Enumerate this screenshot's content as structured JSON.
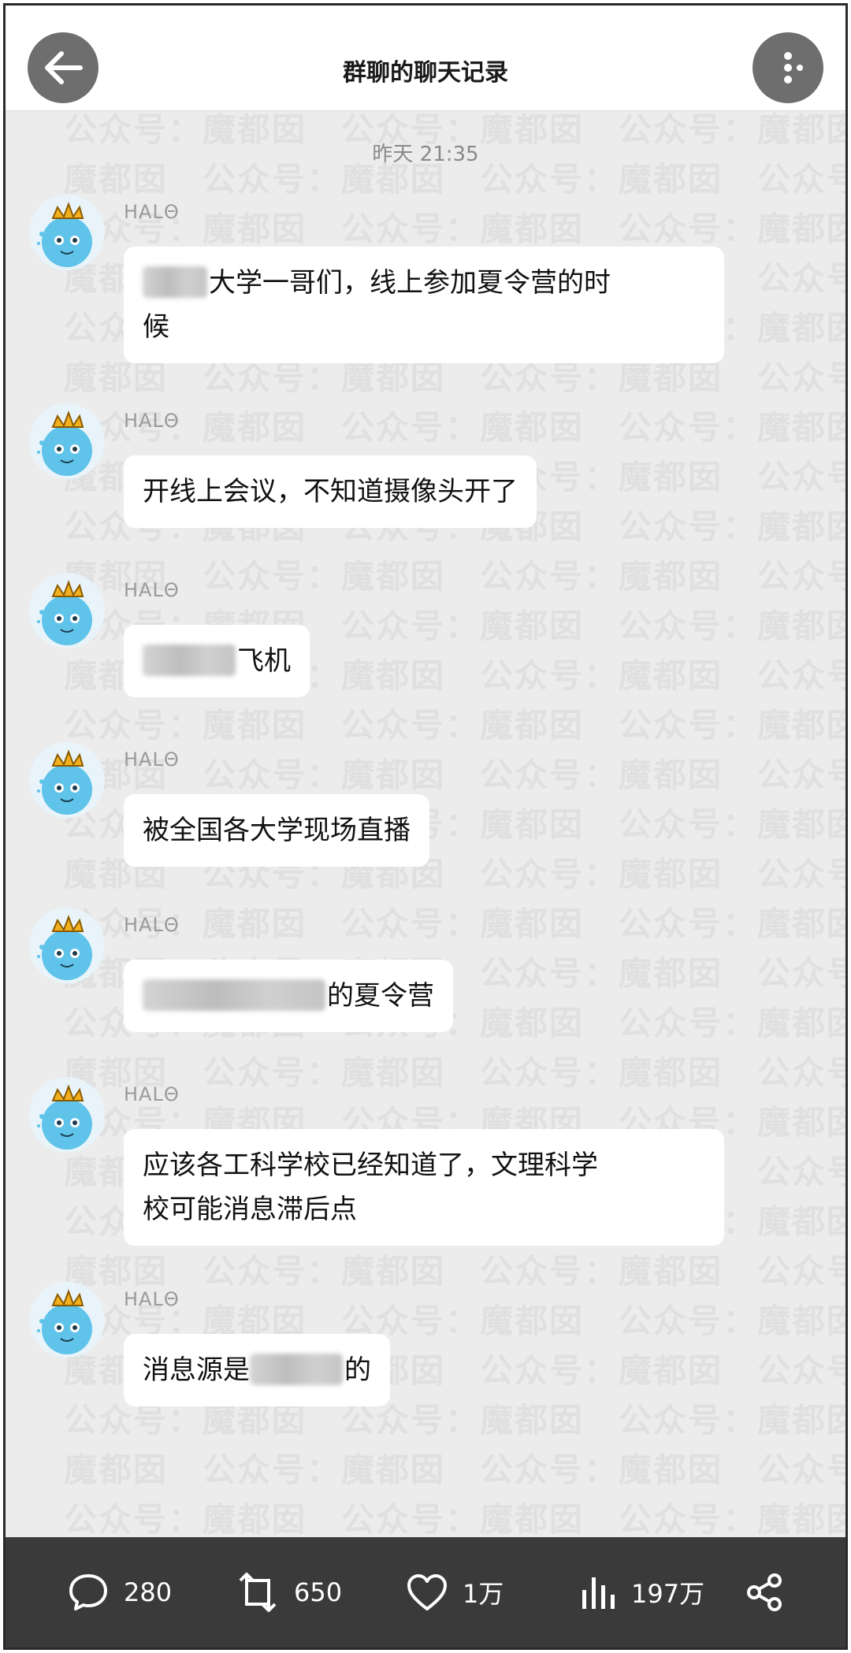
{
  "header": {
    "title": "群聊的聊天记录",
    "back_icon": "back-arrow-icon",
    "more_icon": "more-dots-icon"
  },
  "timestamp": "昨天 21:35",
  "watermark": {
    "text_a": "公众号：",
    "text_b": "魔都囡"
  },
  "messages": [
    {
      "sender": "HALΘ",
      "line1_suffix": "大学一哥们，线上参加夏令营的时",
      "line2": "候"
    },
    {
      "sender": "HALΘ",
      "text": "开线上会议，不知道摄像头开了"
    },
    {
      "sender": "HALΘ",
      "suffix": "飞机"
    },
    {
      "sender": "HALΘ",
      "text": "被全国各大学现场直播"
    },
    {
      "sender": "HALΘ",
      "suffix": "的夏令营"
    },
    {
      "sender": "HALΘ",
      "line1": "应该各工科学校已经知道了，文理科学",
      "line2": "校可能消息滞后点"
    },
    {
      "sender": "HALΘ",
      "prefix": "消息源是",
      "suffix": "的"
    }
  ],
  "footer": {
    "comments": "280",
    "reposts": "650",
    "likes": "1万",
    "views": "197万",
    "comment_icon": "comment-icon",
    "repost_icon": "repost-icon",
    "like_icon": "heart-icon",
    "views_icon": "bar-chart-icon",
    "share_icon": "share-icon"
  },
  "colors": {
    "background": "#ececec",
    "bubble": "#ffffff",
    "footer": "#3a3a3a",
    "button": "#6e6e6e"
  }
}
